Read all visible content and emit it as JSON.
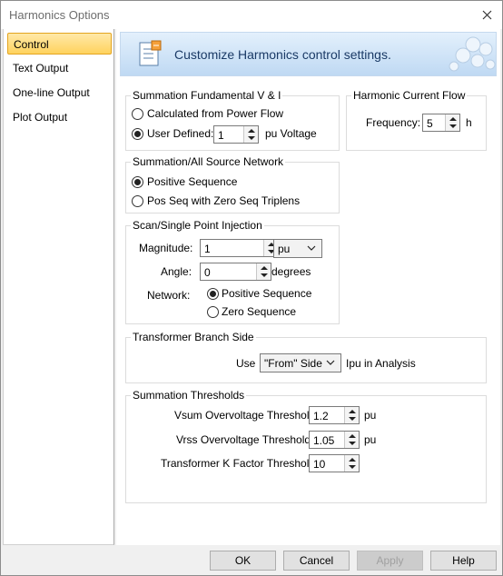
{
  "window": {
    "title": "Harmonics Options"
  },
  "sidebar": {
    "items": [
      {
        "label": "Control"
      },
      {
        "label": "Text Output"
      },
      {
        "label": "One-line Output"
      },
      {
        "label": "Plot Output"
      }
    ]
  },
  "banner": {
    "text": "Customize Harmonics control settings."
  },
  "summation_fundamental": {
    "legend": "Summation Fundamental V & I",
    "option_calculated": "Calculated from Power Flow",
    "option_user": "User Defined:",
    "user_value": "1",
    "unit": "pu Voltage",
    "selected": "user"
  },
  "harmonic_current_flow": {
    "legend": "Harmonic Current Flow",
    "frequency_label": "Frequency:",
    "frequency_value": "5",
    "unit": "h"
  },
  "summation_network": {
    "legend": "Summation/All Source Network",
    "option_positive": "Positive Sequence",
    "option_zero_triplens": "Pos Seq with Zero Seq Triplens",
    "selected": "positive"
  },
  "scan_injection": {
    "legend": "Scan/Single Point Injection",
    "magnitude_label": "Magnitude:",
    "magnitude_value": "1",
    "magnitude_unit": "pu",
    "angle_label": "Angle:",
    "angle_value": "0",
    "angle_unit": "degrees",
    "network_label": "Network:",
    "option_positive": "Positive Sequence",
    "option_zero": "Zero Sequence",
    "selected": "positive"
  },
  "transformer_branch": {
    "legend": "Transformer Branch Side",
    "use_label": "Use",
    "side_value": "\"From\" Side",
    "suffix": "Ipu in Analysis"
  },
  "summation_thresholds": {
    "legend": "Summation Thresholds",
    "vsum_label": "Vsum Overvoltage Threshold:",
    "vsum_value": "1.2",
    "vsum_unit": "pu",
    "vrss_label": "Vrss Overvoltage Threshold:",
    "vrss_value": "1.05",
    "vrss_unit": "pu",
    "kfactor_label": "Transformer K Factor Threshold:",
    "kfactor_value": "10"
  },
  "footer": {
    "ok": "OK",
    "cancel": "Cancel",
    "apply": "Apply",
    "help": "Help"
  },
  "colors": {
    "selection": "#ffd35e",
    "banner": "#bfd9f3"
  }
}
